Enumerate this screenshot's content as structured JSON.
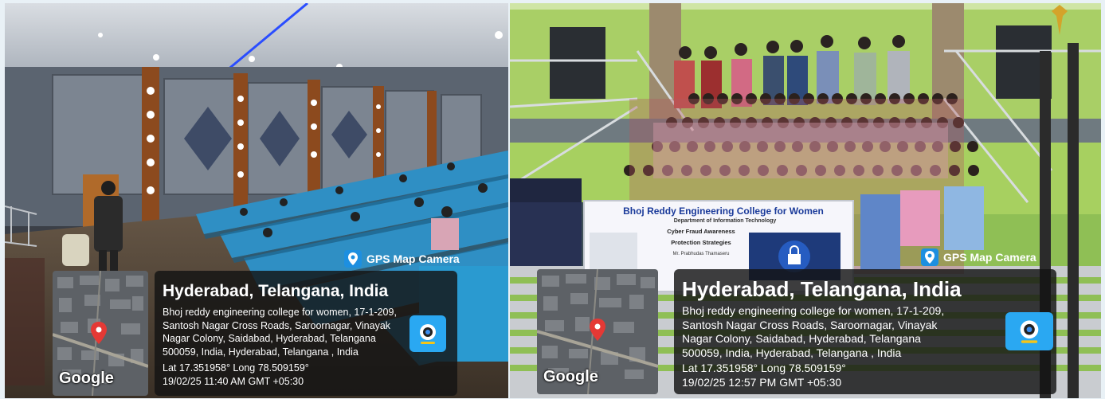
{
  "left": {
    "brand": "GPS Map Camera",
    "map_logo": "Google",
    "city": "Hyderabad, Telangana, India",
    "address": "Bhoj reddy engineering college for women, 17-1-209,\nSantosh Nagar Cross Roads, Saroornagar, Vinayak\nNagar Colony, Saidabad, Hyderabad, Telangana\n500059, India, Hyderabad, Telangana , India",
    "coords": "Lat 17.351958° Long 78.509159°",
    "datetime": "19/02/25 11:40 AM GMT +05:30"
  },
  "right": {
    "brand": "GPS Map Camera",
    "map_logo": "Google",
    "city": "Hyderabad, Telangana, India",
    "address": "Bhoj reddy engineering college for women, 17-1-209,\nSantosh Nagar Cross Roads, Saroornagar, Vinayak\nNagar Colony, Saidabad, Hyderabad, Telangana\n500059, India, Hyderabad, Telangana , India",
    "coords": "Lat 17.351958° Long 78.509159°",
    "datetime": "19/02/25 12:57 PM GMT +05:30",
    "banner": {
      "title": "Bhoj Reddy Engineering College for Women",
      "dept": "Department of Information Technology",
      "line1": "Cyber Fraud Awareness",
      "line2": "Protection Strategies",
      "speaker": "Mr. Prabhudas Thamaseru"
    }
  },
  "colors": {
    "pin": "#e53935",
    "overlay": "#141414",
    "brand_icon": "#1d8fe0"
  }
}
